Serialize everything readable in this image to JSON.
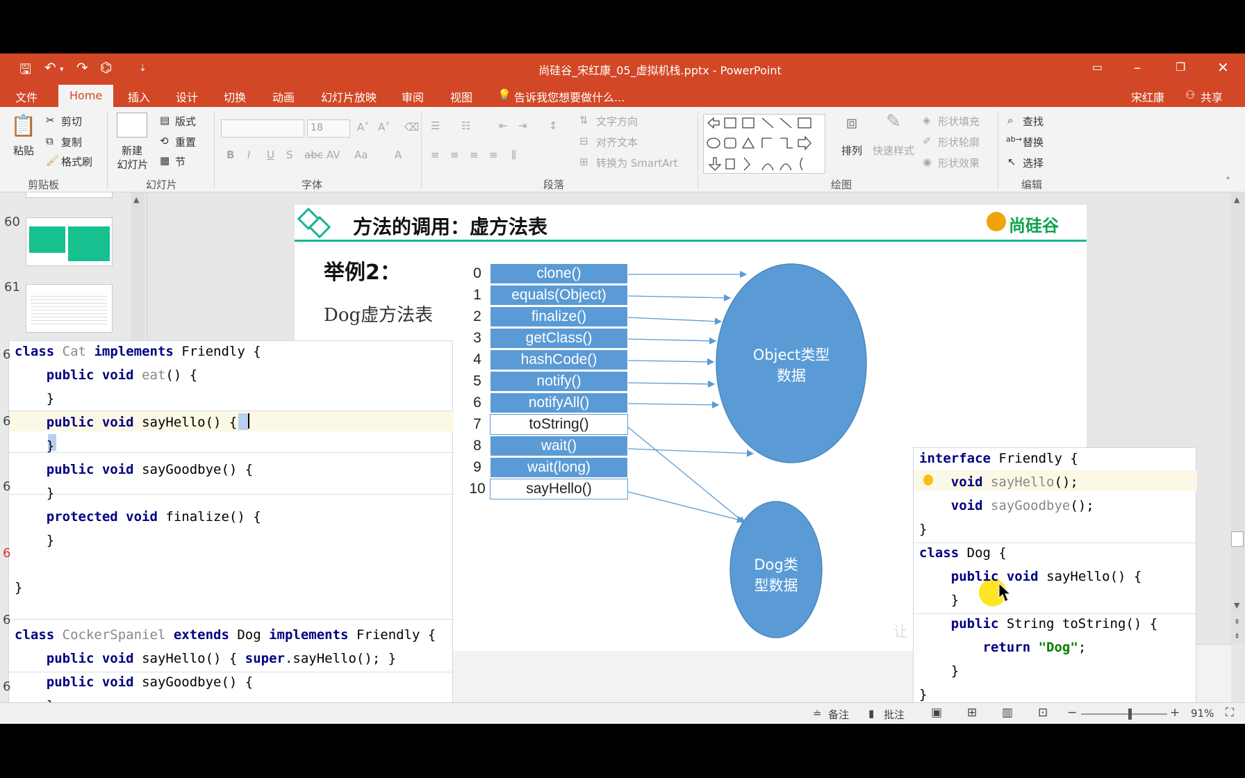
{
  "window": {
    "title": "尚硅谷_宋红康_05_虚拟机栈.pptx - PowerPoint"
  },
  "menu": {
    "file": "文件",
    "home": "Home",
    "insert": "插入",
    "design": "设计",
    "transitions": "切换",
    "animations": "动画",
    "slideshow": "幻灯片放映",
    "review": "审阅",
    "view": "视图",
    "tellme": "告诉我您想要做什么...",
    "user": "宋红康",
    "share": "共享"
  },
  "ribbon": {
    "clipboard": {
      "paste": "粘贴",
      "cut": "剪切",
      "copy": "复制",
      "format_painter": "格式刷",
      "label": "剪贴板"
    },
    "slides": {
      "new_slide_1": "新建",
      "new_slide_2": "幻灯片",
      "layout": "版式",
      "reset": "重置",
      "section": "节",
      "label": "幻灯片"
    },
    "font": {
      "size": "18",
      "label": "字体"
    },
    "paragraph": {
      "text_direction": "文字方向",
      "align_text": "对齐文本",
      "smartart": "转换为 SmartArt",
      "label": "段落"
    },
    "drawing": {
      "arrange": "排列",
      "quick_styles": "快速样式",
      "shape_fill": "形状填充",
      "shape_outline": "形状轮廓",
      "shape_effects": "形状效果",
      "label": "绘图"
    },
    "editing": {
      "find": "查找",
      "replace": "替换",
      "select": "选择",
      "label": "编辑"
    }
  },
  "thumbnails": [
    {
      "num": "60"
    },
    {
      "num": "61"
    }
  ],
  "gutter_marks": [
    "6",
    "6",
    "6",
    "6",
    "6",
    "6"
  ],
  "slide": {
    "title": "方法的调用：虚方法表",
    "logo": "尚硅谷",
    "example": "举例2：",
    "subtitle": "Dog虚方法表",
    "object_label": "Object类型\n数据",
    "dog_label": "Dog类\n型数据",
    "watermark": "让"
  },
  "vtable": [
    {
      "idx": "0",
      "name": "clone()",
      "style": "blue"
    },
    {
      "idx": "1",
      "name": "equals(Object)",
      "style": "blue"
    },
    {
      "idx": "2",
      "name": "finalize()",
      "style": "blue"
    },
    {
      "idx": "3",
      "name": "getClass()",
      "style": "blue"
    },
    {
      "idx": "4",
      "name": "hashCode()",
      "style": "blue"
    },
    {
      "idx": "5",
      "name": "notify()",
      "style": "blue"
    },
    {
      "idx": "6",
      "name": "notifyAll()",
      "style": "blue"
    },
    {
      "idx": "7",
      "name": "toString()",
      "style": "white"
    },
    {
      "idx": "8",
      "name": "wait()",
      "style": "blue"
    },
    {
      "idx": "9",
      "name": "wait(long)",
      "style": "blue"
    },
    {
      "idx": "10",
      "name": "sayHello()",
      "style": "white"
    }
  ],
  "code_left": [
    [
      {
        "t": "class",
        "c": "kw"
      },
      {
        "t": " "
      },
      {
        "t": "Cat",
        "c": "dim"
      },
      {
        "t": " "
      },
      {
        "t": "implements",
        "c": "kw"
      },
      {
        "t": " Friendly {"
      }
    ],
    [
      {
        "t": "    "
      },
      {
        "t": "public",
        "c": "kw"
      },
      {
        "t": " "
      },
      {
        "t": "void",
        "c": "kw"
      },
      {
        "t": " "
      },
      {
        "t": "eat",
        "c": "dim"
      },
      {
        "t": "() {"
      }
    ],
    [
      {
        "t": "    }"
      }
    ],
    [
      {
        "t": "    "
      },
      {
        "t": "public",
        "c": "kw"
      },
      {
        "t": " "
      },
      {
        "t": "void",
        "c": "kw"
      },
      {
        "t": " sayHello() {"
      }
    ],
    [
      {
        "t": "    }"
      }
    ],
    [
      {
        "t": "    "
      },
      {
        "t": "public",
        "c": "kw"
      },
      {
        "t": " "
      },
      {
        "t": "void",
        "c": "kw"
      },
      {
        "t": " sayGoodbye() {"
      }
    ],
    [
      {
        "t": "    }"
      }
    ],
    [
      {
        "t": "    "
      },
      {
        "t": "protected",
        "c": "kw"
      },
      {
        "t": " "
      },
      {
        "t": "void",
        "c": "kw"
      },
      {
        "t": " finalize() {"
      }
    ],
    [
      {
        "t": "    }"
      }
    ],
    [
      {
        "t": ""
      }
    ],
    [
      {
        "t": "}"
      }
    ],
    [
      {
        "t": ""
      }
    ],
    [
      {
        "t": "class",
        "c": "kw"
      },
      {
        "t": " "
      },
      {
        "t": "CockerSpaniel",
        "c": "dim"
      },
      {
        "t": " "
      },
      {
        "t": "extends",
        "c": "kw"
      },
      {
        "t": " Dog "
      },
      {
        "t": "implements",
        "c": "kw"
      },
      {
        "t": " Friendly {"
      }
    ],
    [
      {
        "t": "    "
      },
      {
        "t": "public",
        "c": "kw"
      },
      {
        "t": " "
      },
      {
        "t": "void",
        "c": "kw"
      },
      {
        "t": " sayHello() { "
      },
      {
        "t": "super",
        "c": "kw"
      },
      {
        "t": ".sayHello(); }"
      }
    ],
    [
      {
        "t": "    "
      },
      {
        "t": "public",
        "c": "kw"
      },
      {
        "t": " "
      },
      {
        "t": "void",
        "c": "kw"
      },
      {
        "t": " sayGoodbye() {"
      }
    ],
    [
      {
        "t": "    }"
      }
    ]
  ],
  "code_right": [
    [
      {
        "t": "interface",
        "c": "kw"
      },
      {
        "t": " Friendly {"
      }
    ],
    [
      {
        "t": "    "
      },
      {
        "t": "void",
        "c": "kw"
      },
      {
        "t": " "
      },
      {
        "t": "sayHello",
        "c": "dim"
      },
      {
        "t": "();"
      }
    ],
    [
      {
        "t": "    "
      },
      {
        "t": "void",
        "c": "kw"
      },
      {
        "t": " "
      },
      {
        "t": "sayGoodbye",
        "c": "dim"
      },
      {
        "t": "();"
      }
    ],
    [
      {
        "t": "}"
      }
    ],
    [
      {
        "t": "class",
        "c": "kw"
      },
      {
        "t": " Dog {"
      }
    ],
    [
      {
        "t": "    "
      },
      {
        "t": "public",
        "c": "kw"
      },
      {
        "t": " "
      },
      {
        "t": "void",
        "c": "kw"
      },
      {
        "t": " sayHello() {"
      }
    ],
    [
      {
        "t": "    }"
      }
    ],
    [
      {
        "t": "    "
      },
      {
        "t": "public",
        "c": "kw"
      },
      {
        "t": " String toString() {"
      }
    ],
    [
      {
        "t": "        "
      },
      {
        "t": "return",
        "c": "kw"
      },
      {
        "t": " "
      },
      {
        "t": "\"Dog\"",
        "c": "str"
      },
      {
        "t": ";"
      }
    ],
    [
      {
        "t": "    }"
      }
    ],
    [
      {
        "t": "}"
      }
    ]
  ],
  "status": {
    "notes": "备注",
    "comments": "批注",
    "zoom": "91%"
  }
}
